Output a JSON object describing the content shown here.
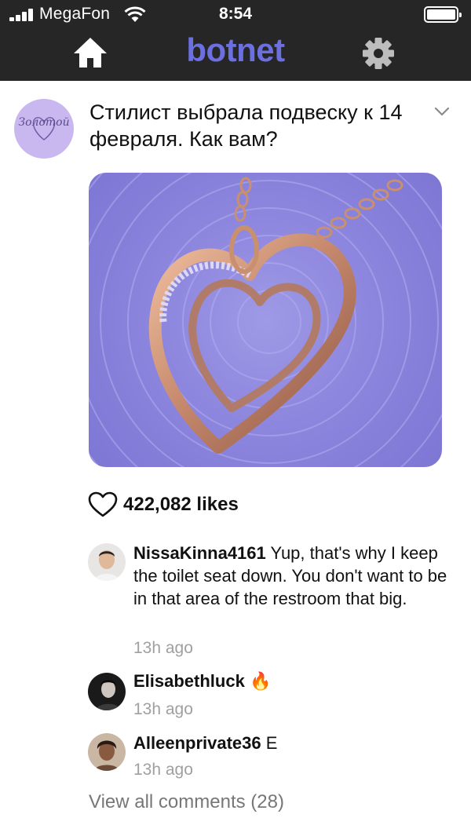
{
  "status_bar": {
    "carrier": "MegaFon",
    "time": "8:54"
  },
  "nav": {
    "brand": "botnet",
    "home_icon": "home-icon",
    "settings_icon": "gear-icon",
    "brand_color": "#6b6fe0",
    "bar_color": "#262626"
  },
  "post": {
    "avatar_text": "Золотой",
    "title": "Стилист выбрала подвеску к 14 февраля. Как вам?",
    "image_subject": "heart-pendant",
    "likes": "422,082 likes"
  },
  "comments": [
    {
      "user": "NissaKinna4161",
      "text": " Yup, that's why I keep the toilet seat down. You don't want to be in that area of the restroom that big.",
      "time": "13h ago"
    },
    {
      "user": "Elisabethluck",
      "text": " 🔥",
      "time": "13h ago"
    },
    {
      "user": "Alleenprivate36",
      "text": " E",
      "time": "13h ago"
    }
  ],
  "view_all": "View all comments (28)"
}
